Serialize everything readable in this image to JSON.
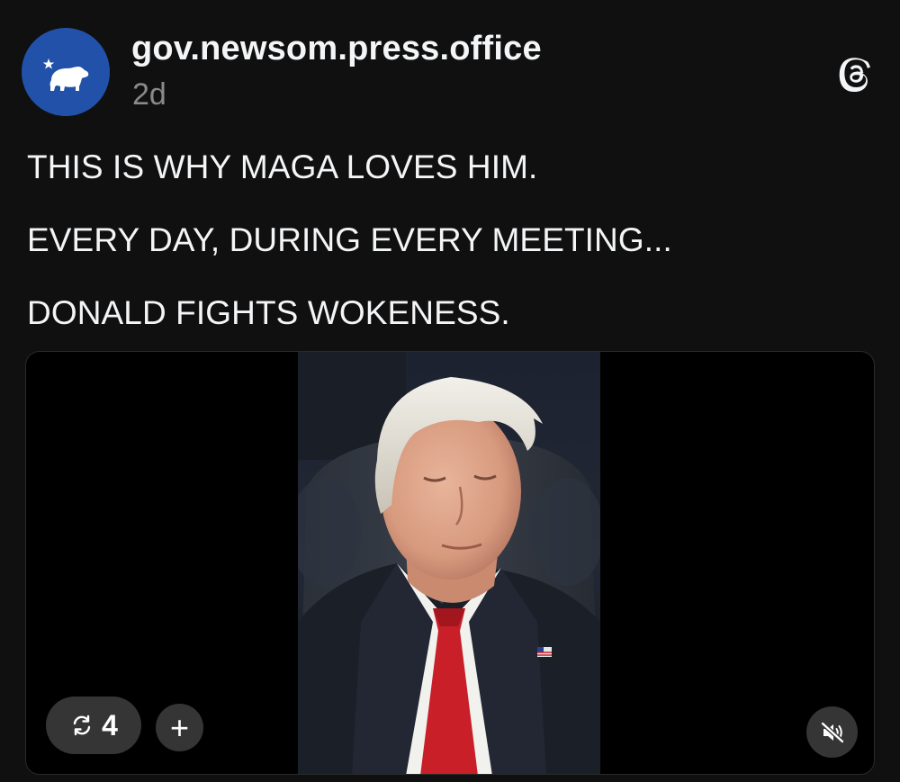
{
  "post": {
    "author": {
      "username": "gov.newsom.press.office",
      "avatar_icon": "california-bear-flag-icon"
    },
    "timestamp": "2d",
    "app_icon": "threads-logo-icon",
    "caption_lines": [
      "THIS IS WHY MAGA LOVES HIM.",
      "EVERY DAY, DURING EVERY MEETING...",
      "DONALD FIGHTS WOKENESS."
    ],
    "media": {
      "type": "video",
      "repost_icon": "repost-icon",
      "repost_count": "4",
      "add_label": "+",
      "mute_icon": "speaker-muted-icon"
    }
  },
  "colors": {
    "background": "#101010",
    "text": "#f3f5f7",
    "muted_text": "#8a8a8a",
    "avatar_bg": "#2151a8",
    "overlay_button": "#3a3a3a"
  }
}
